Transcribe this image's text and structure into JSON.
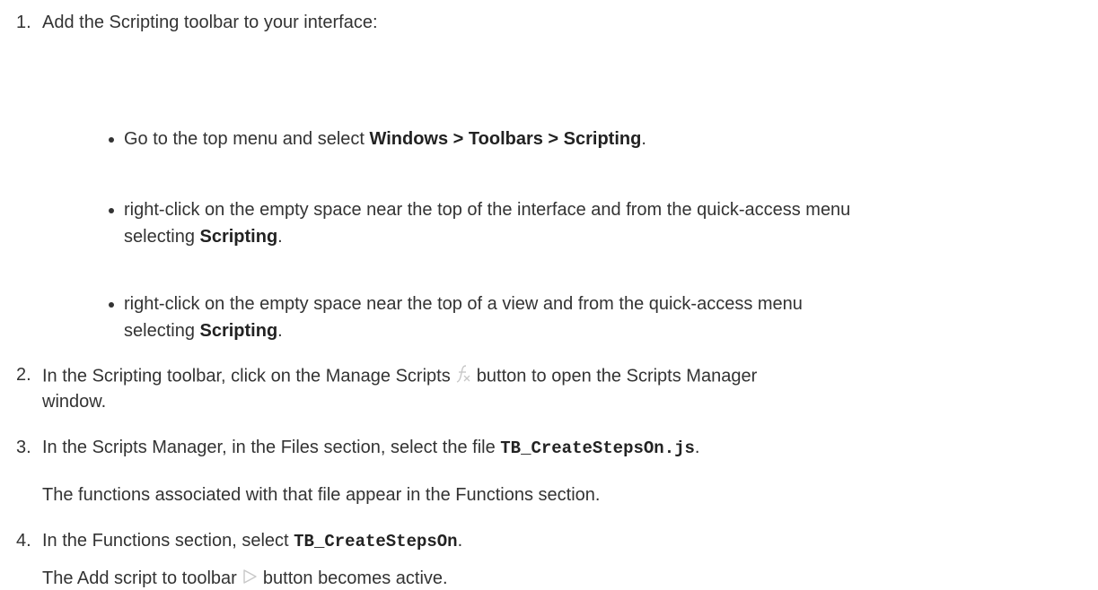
{
  "steps": [
    {
      "number": "1.",
      "text": "Add the Scripting toolbar to your interface:",
      "bullets": [
        {
          "pre": "Go to the top menu and select ",
          "bold": "Windows > Toolbars > Scripting",
          "post": "."
        },
        {
          "line1": "right-click on the empty space near the top of the interface and from the quick-access menu",
          "pre": "selecting ",
          "bold": "Scripting",
          "post": "."
        },
        {
          "line1": "right-click on the empty space near the top of a view and from the quick-access menu",
          "pre": "selecting ",
          "bold": "Scripting",
          "post": "."
        }
      ]
    },
    {
      "number": "2.",
      "pre": "In the Scripting toolbar, click on the Manage Scripts ",
      "post": " button to open the Scripts Manager",
      "line2": "window.",
      "icon": "manage-scripts-icon"
    },
    {
      "number": "3.",
      "pre": "In the Scripts Manager, in the Files section, select the file ",
      "code": "TB_CreateStepsOn.js",
      "post": ".",
      "note": "The functions associated with that file appear in the Functions section."
    },
    {
      "number": "4.",
      "pre": "In the Functions section, select ",
      "code": "TB_CreateStepsOn",
      "post": ".",
      "note_pre": "The Add script to toolbar ",
      "note_post": " button becomes active.",
      "icon": "add-script-to-toolbar-icon"
    }
  ],
  "colors": {
    "text": "#333333",
    "icon": "#c8c8c8"
  }
}
